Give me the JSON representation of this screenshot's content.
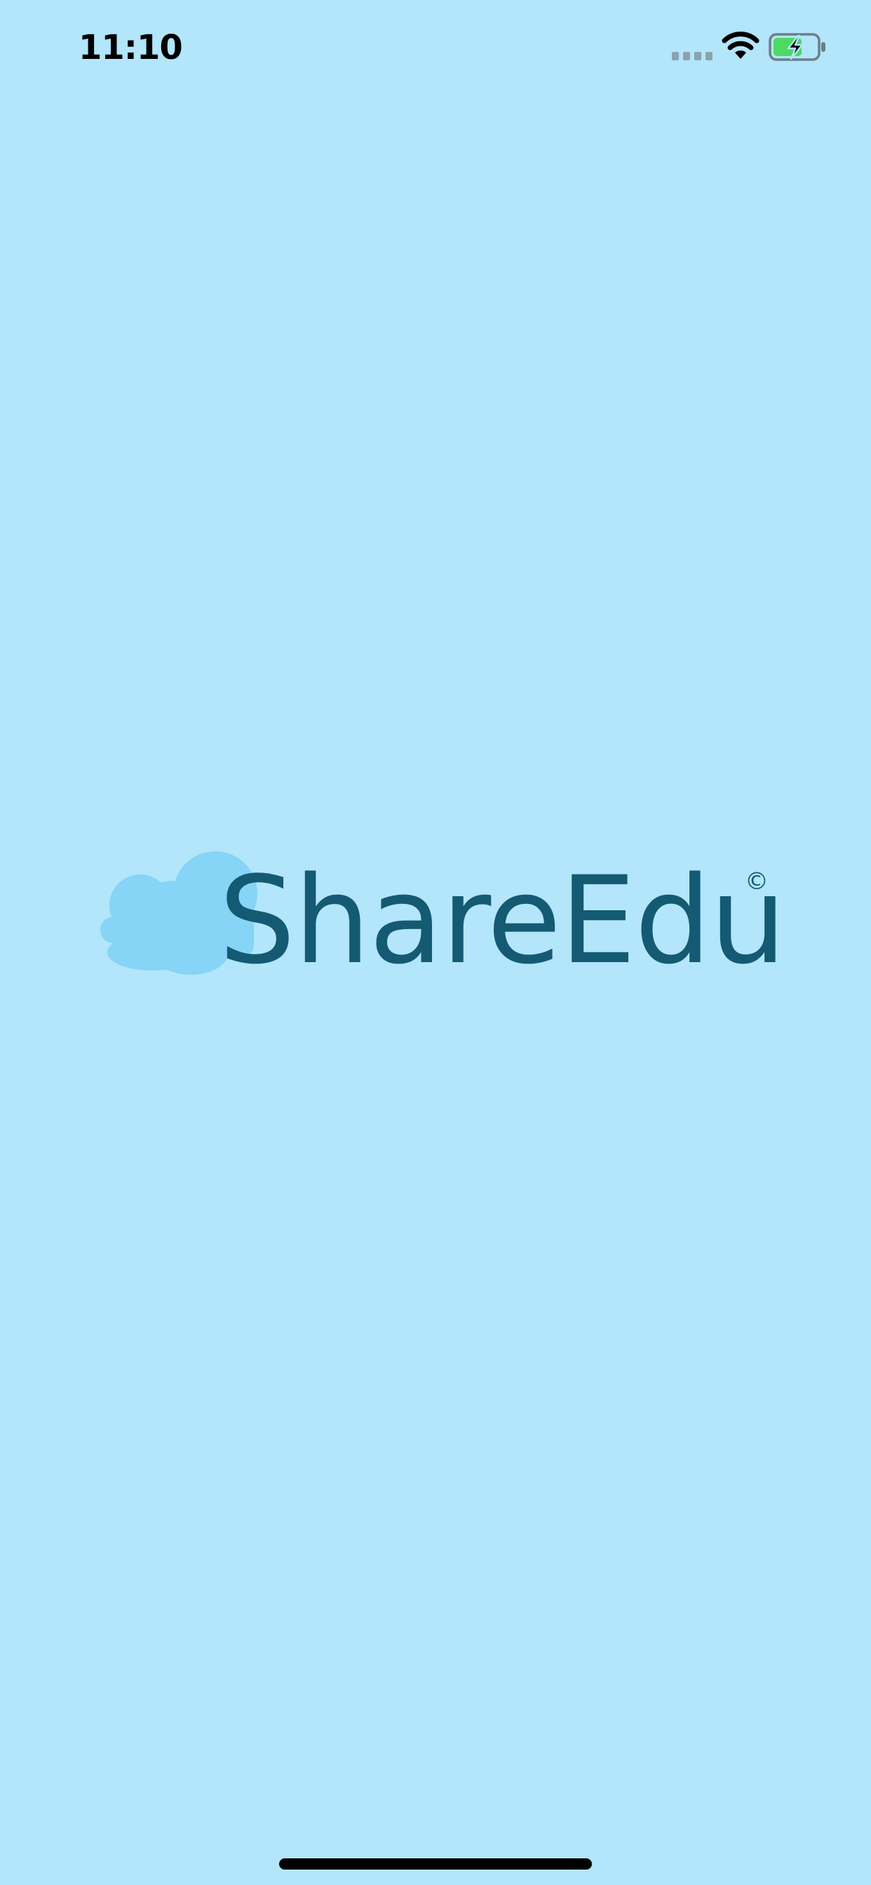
{
  "status_bar": {
    "time": "11:10",
    "icons": {
      "signal": "cellular-signal-icon",
      "wifi": "wifi-icon",
      "battery": "battery-charging-icon"
    }
  },
  "splash": {
    "logo_text": "ShareEdu",
    "copyright_symbol": "©",
    "logo_icon": "cloud-icon"
  },
  "colors": {
    "background": "#b3e5fb",
    "logo_text": "#145a72",
    "cloud": "#86d4f6",
    "battery_fill": "#4cd964"
  }
}
